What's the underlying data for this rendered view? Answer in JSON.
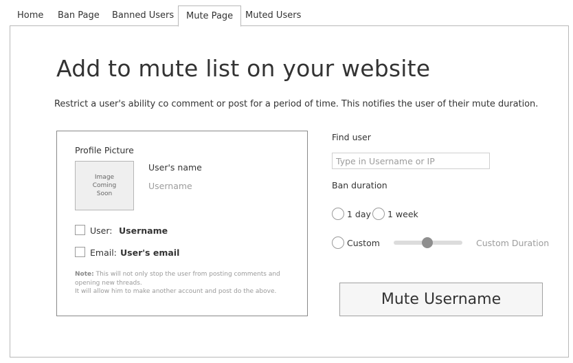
{
  "tabs": [
    {
      "label": "Home"
    },
    {
      "label": "Ban Page"
    },
    {
      "label": "Banned Users"
    },
    {
      "label": "Mute Page",
      "active": true
    },
    {
      "label": "Muted Users"
    }
  ],
  "page": {
    "title": "Add to mute list on your website",
    "description": "Restrict a user's ability co comment or post for a period of time. This notifies the user of their mute duration."
  },
  "user_card": {
    "profile_picture_label": "Profile Picture",
    "avatar_placeholder": "Image\nComing\nSoon",
    "username_label": "User's name",
    "username_placeholder": "Username",
    "user_check_label": "User:",
    "user_check_value": "Username",
    "email_check_label": "Email:",
    "email_check_value": "User's email",
    "note_heading": "Note:",
    "note_line1": "This will not only stop the user from posting comments and",
    "note_line2": "opening new threads.",
    "note_line3": "It will allow him to make another account and post do the above."
  },
  "find_user": {
    "label": "Find user",
    "placeholder": "Type in Username or IP"
  },
  "duration": {
    "label": "Ban duration",
    "options": [
      {
        "label": "1 day"
      },
      {
        "label": "1 week"
      },
      {
        "label": "Custom"
      }
    ],
    "custom_placeholder": "Custom Duration"
  },
  "actions": {
    "mute_label": "Mute Username"
  }
}
